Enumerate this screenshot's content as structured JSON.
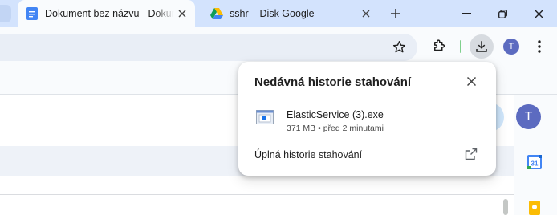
{
  "tabs": [
    {
      "title": "Dokument bez názvu - Dokumenty Google",
      "icon": "google-docs-icon",
      "active": true
    },
    {
      "title": "sshr – Disk Google",
      "icon": "google-drive-icon",
      "active": false
    }
  ],
  "toolbar": {
    "profile_initial": "T"
  },
  "page": {
    "account_initial": "T",
    "calendar_day": "31"
  },
  "download_popup": {
    "title": "Nedávná historie stahování",
    "item": {
      "file_name": "ElasticService (3).exe",
      "meta": "371 MB • před 2 minutami"
    },
    "history_link": "Úplná historie stahování"
  },
  "colors": {
    "tabstrip_bg": "#d3e3fd",
    "toolbar_bg": "#f9fbfd",
    "accent_avatar": "#5c6bc0"
  }
}
